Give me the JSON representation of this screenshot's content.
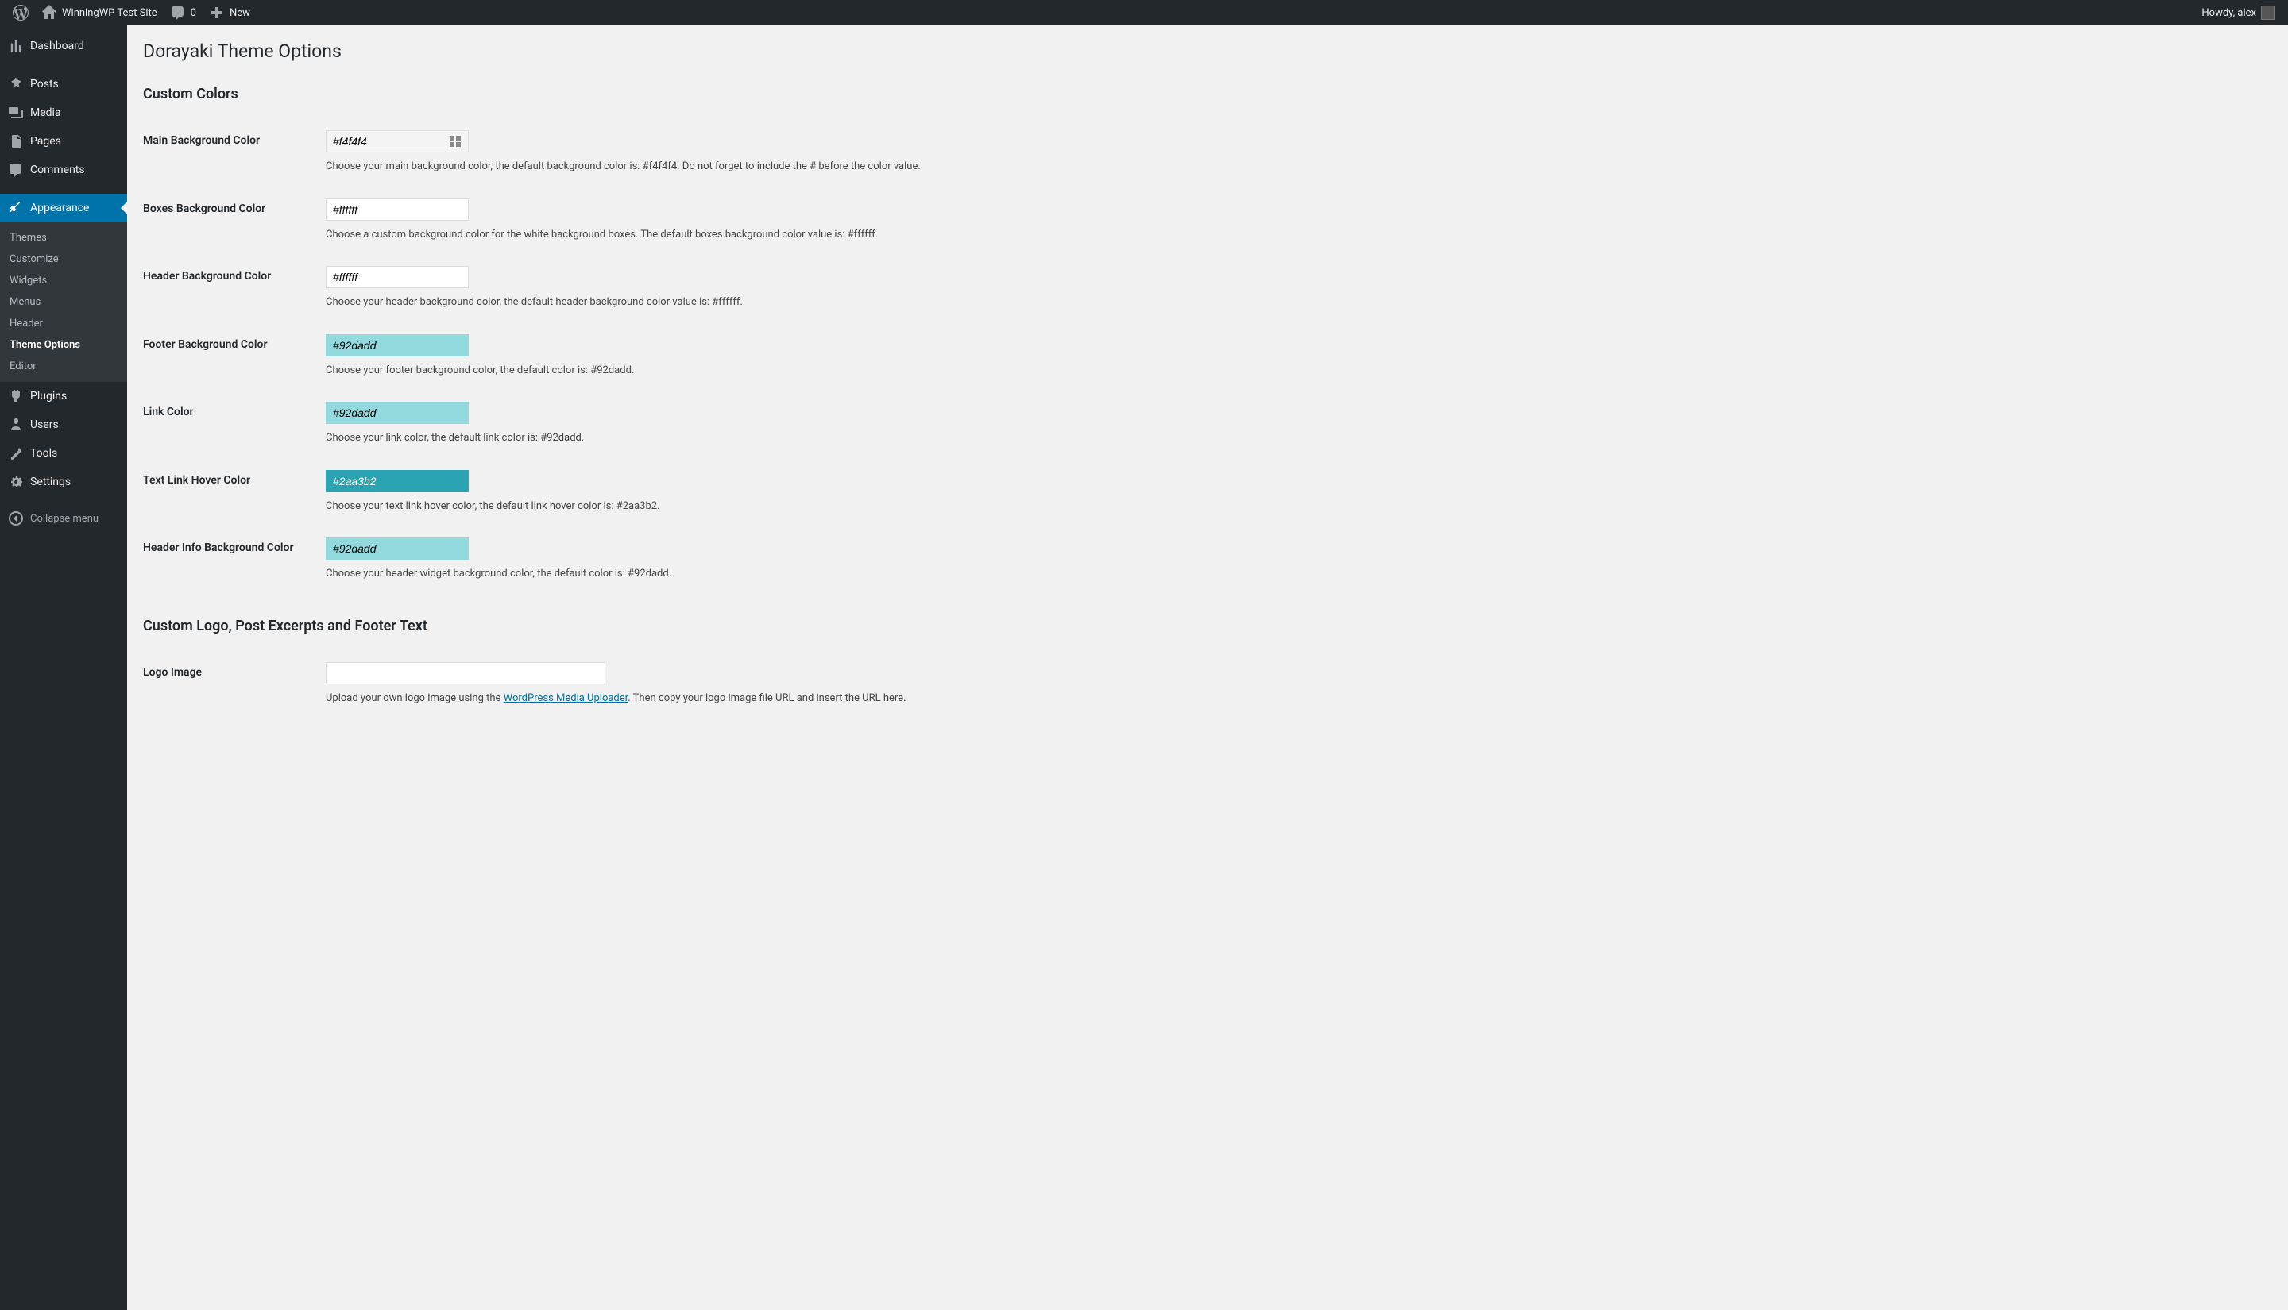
{
  "adminBar": {
    "siteName": "WinningWP Test Site",
    "commentCount": "0",
    "newLabel": "New",
    "greeting": "Howdy, alex"
  },
  "sidebar": {
    "items": [
      {
        "name": "dashboard",
        "label": "Dashboard"
      },
      {
        "name": "posts",
        "label": "Posts"
      },
      {
        "name": "media",
        "label": "Media"
      },
      {
        "name": "pages",
        "label": "Pages"
      },
      {
        "name": "comments",
        "label": "Comments"
      },
      {
        "name": "appearance",
        "label": "Appearance"
      },
      {
        "name": "plugins",
        "label": "Plugins"
      },
      {
        "name": "users",
        "label": "Users"
      },
      {
        "name": "tools",
        "label": "Tools"
      },
      {
        "name": "settings",
        "label": "Settings"
      }
    ],
    "submenu": [
      {
        "name": "themes",
        "label": "Themes"
      },
      {
        "name": "customize",
        "label": "Customize"
      },
      {
        "name": "widgets",
        "label": "Widgets"
      },
      {
        "name": "menus",
        "label": "Menus"
      },
      {
        "name": "header",
        "label": "Header"
      },
      {
        "name": "theme-options",
        "label": "Theme Options"
      },
      {
        "name": "editor",
        "label": "Editor"
      }
    ],
    "collapseLabel": "Collapse menu"
  },
  "page": {
    "title": "Dorayaki Theme Options",
    "section1": "Custom Colors",
    "section2": "Custom Logo, Post Excerpts and Footer Text"
  },
  "fields": {
    "mainBg": {
      "label": "Main Background Color",
      "value": "#f4f4f4",
      "desc": "Choose your main background color, the default background color is: #f4f4f4. Do not forget to include the # before the color value."
    },
    "boxesBg": {
      "label": "Boxes Background Color",
      "value": "#ffffff",
      "desc": "Choose a custom background color for the white background boxes. The default boxes background color value is: #ffffff."
    },
    "headerBg": {
      "label": "Header Background Color",
      "value": "#ffffff",
      "desc": "Choose your header background color, the default header background color value is: #ffffff."
    },
    "footerBg": {
      "label": "Footer Background Color",
      "value": "#92dadd",
      "desc": "Choose your footer background color, the default color is: #92dadd."
    },
    "linkColor": {
      "label": "Link Color",
      "value": "#92dadd",
      "desc": "Choose your link color, the default link color is: #92dadd."
    },
    "textLinkHover": {
      "label": "Text Link Hover Color",
      "value": "#2aa3b2",
      "desc": "Choose your text link hover color, the default link hover color is: #2aa3b2."
    },
    "headerInfoBg": {
      "label": "Header Info Background Color",
      "value": "#92dadd",
      "desc": "Choose your header widget background color, the default color is: #92dadd."
    },
    "logoImage": {
      "label": "Logo Image",
      "value": "",
      "descPre": "Upload your own logo image using the ",
      "descLink": "WordPress Media Uploader",
      "descPost": ". Then copy your logo image file URL and insert the URL here."
    }
  }
}
